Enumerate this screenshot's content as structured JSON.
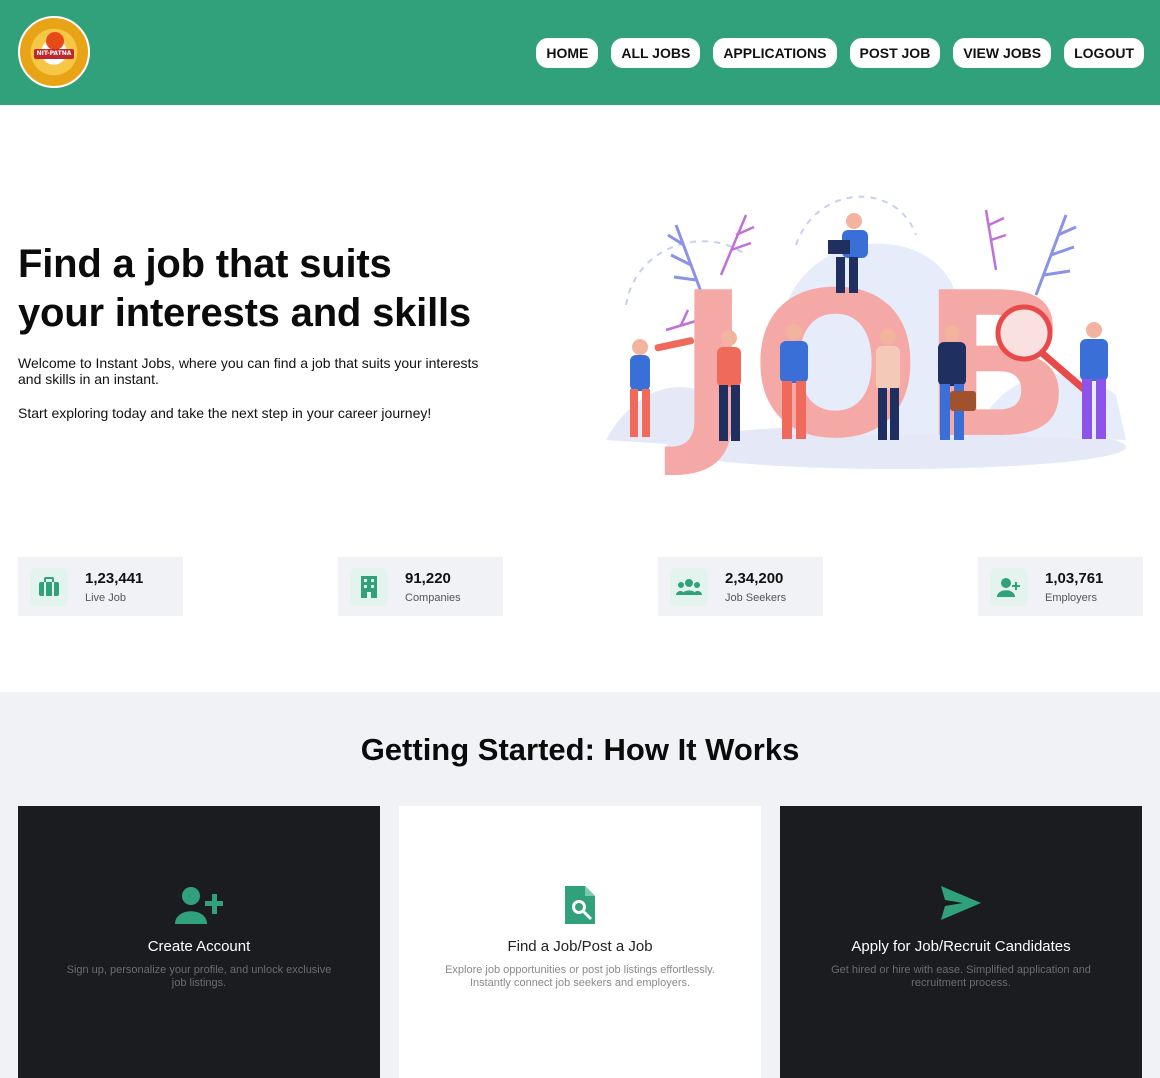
{
  "header": {
    "logo_text": "NIT-PATNA",
    "nav": [
      {
        "label": "HOME"
      },
      {
        "label": "ALL JOBS"
      },
      {
        "label": "APPLICATIONS"
      },
      {
        "label": "POST JOB"
      },
      {
        "label": "VIEW JOBS"
      },
      {
        "label": "LOGOUT"
      }
    ],
    "color": "#31a17c"
  },
  "hero": {
    "title_line1": "Find a job that suits",
    "title_line2": "your interests and skills",
    "paragraph1": "Welcome to Instant Jobs, where you can find a job that suits your interests and skills in an instant.",
    "paragraph2": "Start exploring today and take the next step in your career journey!",
    "illustration_text": "JOB"
  },
  "stats": [
    {
      "value": "1,23,441",
      "label": "Live Job",
      "icon": "briefcase-icon"
    },
    {
      "value": "91,220",
      "label": "Companies",
      "icon": "building-icon"
    },
    {
      "value": "2,34,200",
      "label": "Job Seekers",
      "icon": "users-icon"
    },
    {
      "value": "1,03,761",
      "label": "Employers",
      "icon": "user-plus-icon"
    }
  ],
  "how_it_works": {
    "title": "Getting Started: How It Works",
    "cards": [
      {
        "title": "Create Account",
        "description": "Sign up, personalize your profile, and unlock exclusive job listings.",
        "icon": "user-plus-icon",
        "theme": "dark"
      },
      {
        "title": "Find a Job/Post a Job",
        "description": "Explore job opportunities or post job listings effortlessly. Instantly connect job seekers and employers.",
        "icon": "file-search-icon",
        "theme": "light"
      },
      {
        "title": "Apply for Job/Recruit Candidates",
        "description": "Get hired or hire with ease. Simplified application and recruitment process.",
        "icon": "send-icon",
        "theme": "dark"
      }
    ]
  },
  "colors": {
    "accent": "#31a17c",
    "dark_card": "#1b1c1f",
    "section_bg": "#f1f2f6"
  }
}
